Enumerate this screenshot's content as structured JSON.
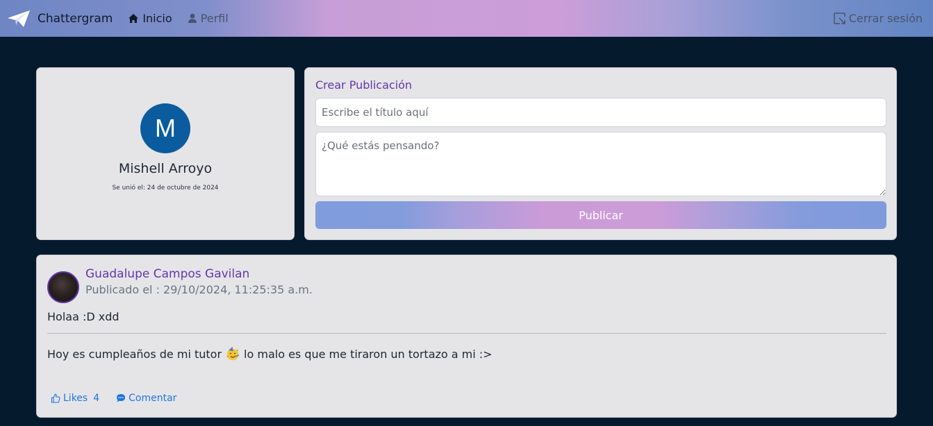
{
  "navbar": {
    "brand": "Chattergram",
    "home_label": "Inicio",
    "profile_label": "Perfil",
    "logout_label": "Cerrar sesión"
  },
  "profile": {
    "avatar_letter": "M",
    "name": "Mishell Arroyo",
    "joined": "Se unió el: 24 de octubre de 2024"
  },
  "create_post": {
    "title": "Crear Publicación",
    "title_placeholder": "Escribe el título aquí",
    "body_placeholder": "¿Qué estás pensando?",
    "publish_label": "Publicar"
  },
  "post": {
    "author": "Guadalupe Campos Gavilan",
    "date": "Publicado el : 29/10/2024, 11:25:35 a.m.",
    "title": "Holaa :D xdd",
    "content_before": "Hoy es cumpleaños de mi tutor",
    "content_after": "lo malo es que me tiraron un tortazo a mi :>",
    "emoji": "party-face-emoji",
    "likes_label": "Likes",
    "likes_count": "4",
    "comment_label": "Comentar"
  },
  "colors": {
    "background": "#061a2e",
    "accent_purple": "#6236ac",
    "link_blue": "#1f75e0",
    "avatar_blue": "#0b5c9e"
  }
}
